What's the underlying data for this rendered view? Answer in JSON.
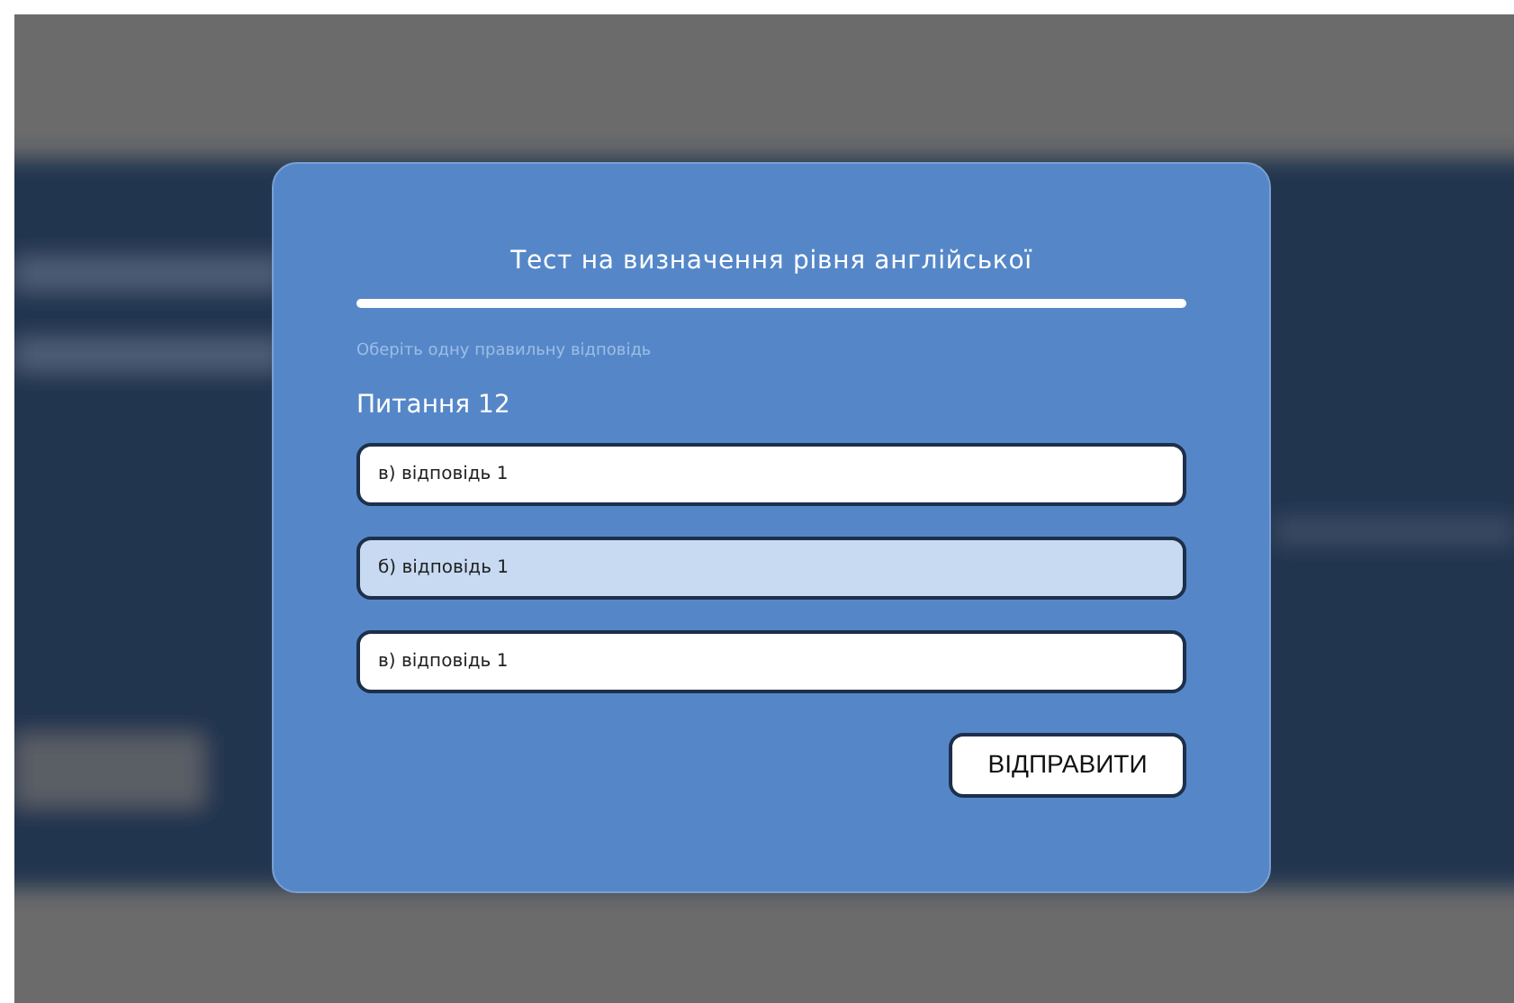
{
  "dialog": {
    "title": "Тест на визначення рівня англійської",
    "hint": "Оберіть одну правильну відповідь",
    "question": "Питання 12",
    "options": [
      {
        "label": "в) відповідь 1",
        "selected": false
      },
      {
        "label": "б) відповідь 1",
        "selected": true
      },
      {
        "label": "в) відповідь 1",
        "selected": false
      }
    ],
    "submit_button": "ВІДПРАВИТИ"
  }
}
